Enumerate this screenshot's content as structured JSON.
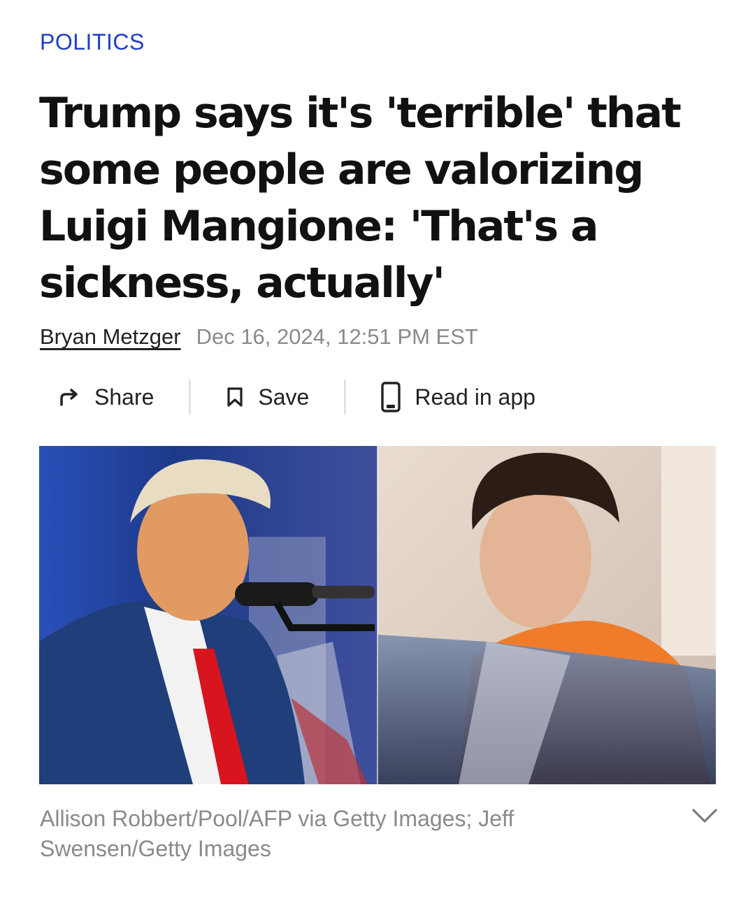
{
  "article": {
    "category": "POLITICS",
    "headline": "Trump says it's 'terrible' that some people are valorizing Luigi Mangione: 'That's a sickness, actually'",
    "author": "Bryan Metzger",
    "date": "Dec 16, 2024, 12:51 PM EST"
  },
  "actions": {
    "share_label": "Share",
    "save_label": "Save",
    "app_label": "Read in app",
    "share_icon": "share-arrow-icon",
    "save_icon": "bookmark-icon",
    "app_icon": "phone-icon"
  },
  "image": {
    "caption": "Allison Robbert/Pool/AFP via Getty Images; Jeff Swensen/Getty Images",
    "toggle_icon": "chevron-down-icon"
  },
  "colors": {
    "category": "#1f3fc4",
    "text": "#111111",
    "muted": "#8a8a8a"
  }
}
